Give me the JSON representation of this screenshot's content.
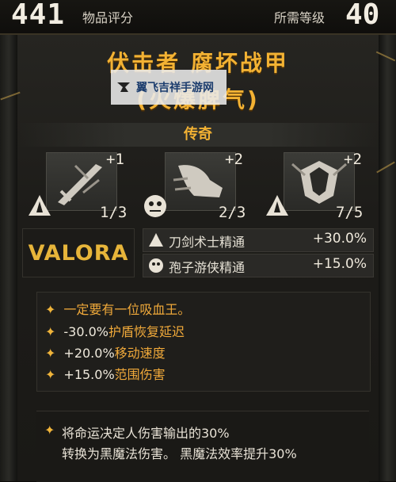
{
  "header": {
    "item_score": "441",
    "item_score_label": "物品评分",
    "required_level_label": "所需等级",
    "required_level": "40"
  },
  "item": {
    "name": "伏击者 腐坏战甲",
    "subtitle": "(火爆脾气)",
    "rarity": "传奇",
    "rarity_color": "#f3b233"
  },
  "watermark": {
    "text": "翼飞吉祥手游网"
  },
  "set_slots": [
    {
      "icon": "sword-skill-icon",
      "bonus": "+1",
      "progress": "1/3",
      "badge": "blade-class-icon"
    },
    {
      "icon": "dash-boot-skill-icon",
      "bonus": "+2",
      "progress": "2/3",
      "badge": "spore-class-icon"
    },
    {
      "icon": "shield-burst-skill-icon",
      "bonus": "+2",
      "progress": "7/5",
      "badge": "blade-class-icon"
    }
  ],
  "brand": {
    "name": "VALORA"
  },
  "masteries": [
    {
      "icon": "blade-class-icon",
      "name": "刀剑术士精通",
      "value": "+30.0%"
    },
    {
      "icon": "spore-class-icon",
      "name": "孢子游侠精通",
      "value": "+15.0%"
    }
  ],
  "stats": [
    {
      "prefix": "",
      "text": "一定要有一位吸血王。",
      "style": "orange"
    },
    {
      "prefix": "-30.0%",
      "text": "护盾恢复延迟",
      "style": "mixed"
    },
    {
      "prefix": "+20.0%",
      "text": "移动速度",
      "style": "mixed"
    },
    {
      "prefix": "+15.0%",
      "text": "范围伤害",
      "style": "mixed"
    }
  ],
  "description": {
    "line1": "将命运决定人伤害输出的30%",
    "line2": "转换为黑魔法伤害。 黑魔法效率提升30%"
  }
}
